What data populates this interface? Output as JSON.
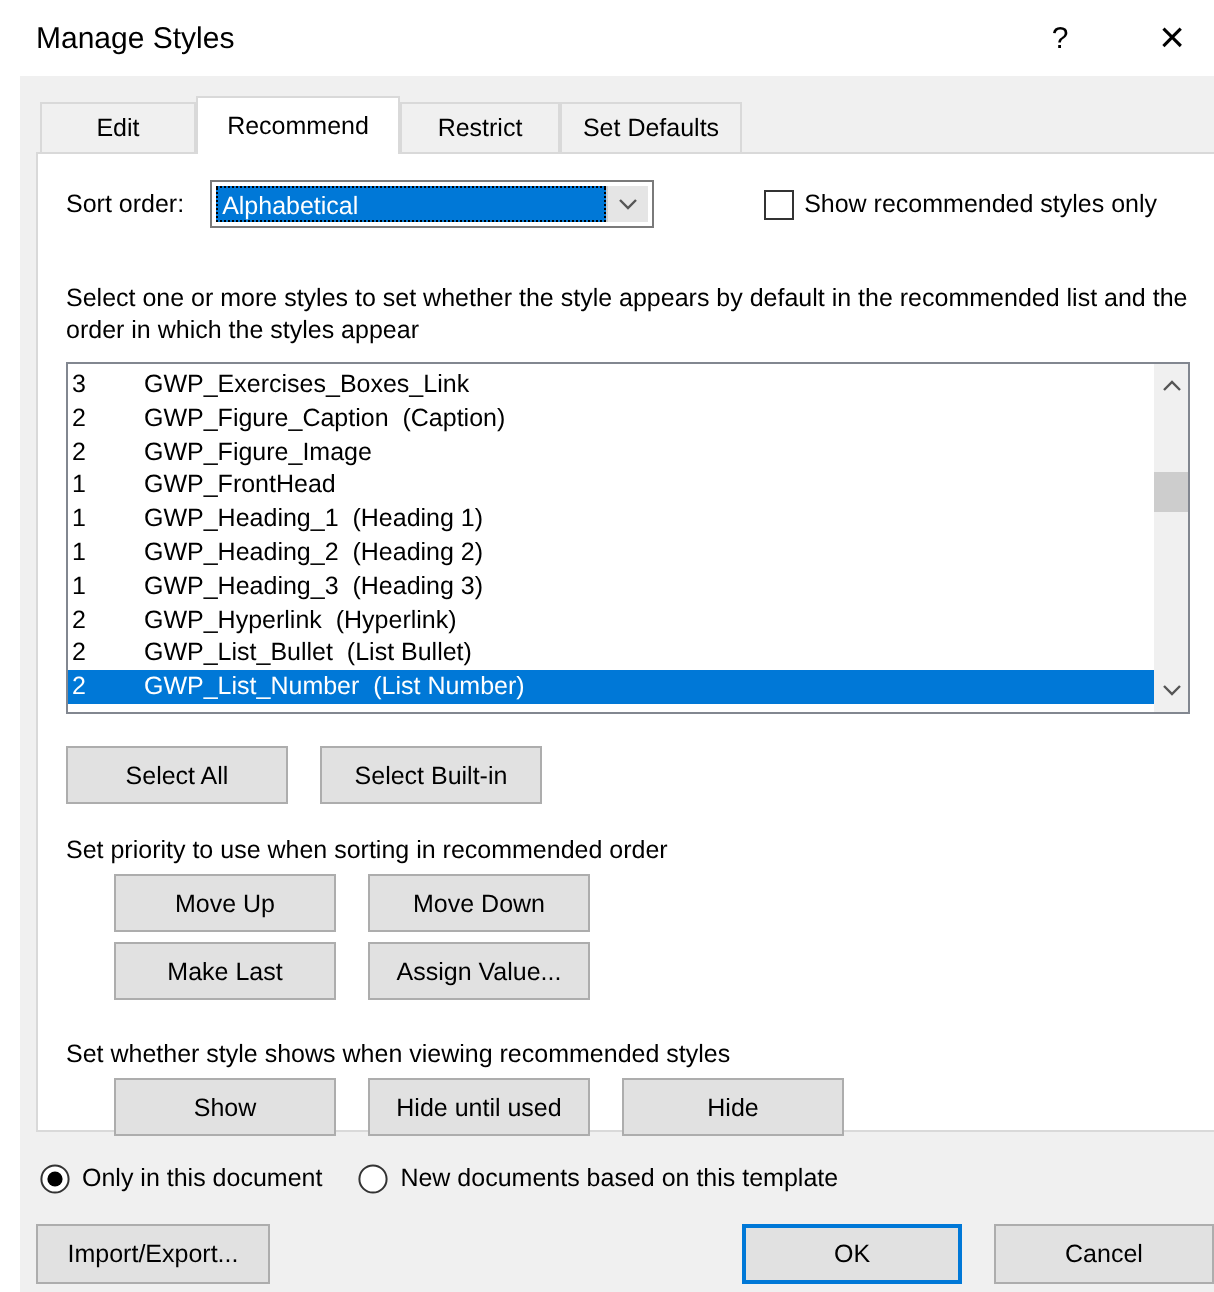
{
  "window": {
    "title": "Manage Styles",
    "help": "?",
    "close": "×"
  },
  "tabs": [
    {
      "label": "Edit",
      "selected": false
    },
    {
      "label": "Recommend",
      "selected": true
    },
    {
      "label": "Restrict",
      "selected": false
    },
    {
      "label": "Set Defaults",
      "selected": false
    }
  ],
  "sort_order": {
    "label": "Sort order:",
    "value": "Alphabetical"
  },
  "show_recommended_only": {
    "label": "Show recommended styles only",
    "checked": false
  },
  "instructions": "Select one or more styles to set whether the style appears by default in the recommended list and the order in which the styles appear",
  "styles": [
    {
      "priority": "3",
      "name": "GWP_Exercises_Boxes_Link",
      "selected": false
    },
    {
      "priority": "2",
      "name": "GWP_Figure_Caption  (Caption)",
      "selected": false
    },
    {
      "priority": "2",
      "name": "GWP_Figure_Image",
      "selected": false
    },
    {
      "priority": "1",
      "name": "GWP_FrontHead",
      "selected": false
    },
    {
      "priority": "1",
      "name": "GWP_Heading_1  (Heading 1)",
      "selected": false
    },
    {
      "priority": "1",
      "name": "GWP_Heading_2  (Heading 2)",
      "selected": false
    },
    {
      "priority": "1",
      "name": "GWP_Heading_3  (Heading 3)",
      "selected": false
    },
    {
      "priority": "2",
      "name": "GWP_Hyperlink  (Hyperlink)",
      "selected": false
    },
    {
      "priority": "2",
      "name": "GWP_List_Bullet  (List Bullet)",
      "selected": false
    },
    {
      "priority": "2",
      "name": "GWP_List_Number  (List Number)",
      "selected": true
    }
  ],
  "select_buttons": [
    "Select All",
    "Select Built-in"
  ],
  "priority_label": "Set priority to use when sorting in recommended order",
  "priority_buttons": [
    [
      "Move Up",
      "Move Down"
    ],
    [
      "Make Last",
      "Assign Value..."
    ]
  ],
  "visibility_label": "Set whether style shows when viewing recommended styles",
  "visibility_buttons": [
    "Show",
    "Hide until used",
    "Hide"
  ],
  "scope": [
    {
      "label": "Only in this document",
      "selected": true
    },
    {
      "label": "New documents based on this template",
      "selected": false
    }
  ],
  "footer_buttons": [
    {
      "label": "Import/Export...",
      "default": false
    },
    {
      "label": "OK",
      "default": true
    },
    {
      "label": "Cancel",
      "default": false
    }
  ]
}
